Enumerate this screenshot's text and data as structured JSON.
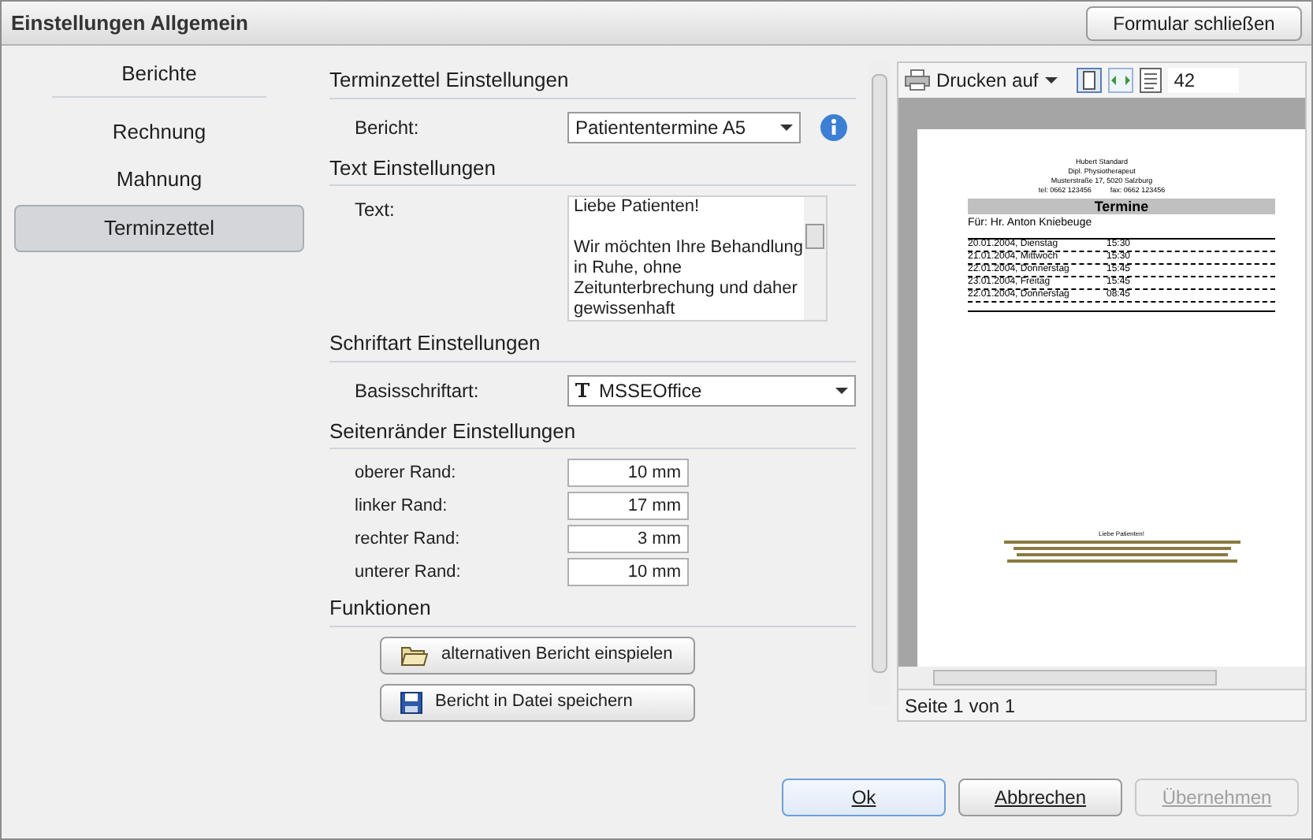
{
  "window": {
    "title": "Einstellungen Allgemein",
    "close_button": "Formular schließen"
  },
  "sidebar": {
    "title": "Berichte",
    "items": [
      {
        "label": "Rechnung",
        "selected": false
      },
      {
        "label": "Mahnung",
        "selected": false
      },
      {
        "label": "Terminzettel",
        "selected": true
      }
    ]
  },
  "settings": {
    "title": "Terminzettel Einstellungen",
    "bericht": {
      "label": "Bericht:",
      "value": "Patiententermine A5"
    },
    "text_section": {
      "title": "Text Einstellungen",
      "label": "Text:",
      "value": "Liebe Patienten!\n\nWir möchten Ihre Behandlung in Ruhe, ohne Zeitunterbrechung und daher gewissenhaft"
    },
    "font_section": {
      "title": "Schriftart Einstellungen",
      "label": "Basisschriftart:",
      "value": "MSSEOffice"
    },
    "margins_section": {
      "title": "Seitenränder Einstellungen",
      "rows": [
        {
          "label": "oberer Rand:",
          "value": "10 mm"
        },
        {
          "label": "linker Rand:",
          "value": "17 mm"
        },
        {
          "label": "rechter Rand:",
          "value": "3 mm"
        },
        {
          "label": "unterer Rand:",
          "value": "10 mm"
        }
      ]
    },
    "functions_section": {
      "title": "Funktionen",
      "buttons": [
        {
          "label": "alternativen Bericht einspielen",
          "kind": "folder"
        },
        {
          "label": "Bericht in Datei speichern",
          "kind": "save"
        }
      ]
    }
  },
  "preview": {
    "print_button": "Drucken auf",
    "zoom": "42",
    "page": {
      "header": [
        "Hubert Standard",
        "Dipl. Physiotherapeut",
        "Musterstraße 17, 5020 Salzburg"
      ],
      "tel": "tel: 0662 123456",
      "fax": "fax: 0662 123456",
      "title": "Termine",
      "recipient": "Für: Hr. Anton Kniebeuge",
      "rows": [
        {
          "date": "20.01.2004, Dienstag",
          "time": "15:30"
        },
        {
          "date": "21.01.2004, Mittwoch",
          "time": "15:30"
        },
        {
          "date": "22.01.2004, Donnerstag",
          "time": "15:45"
        },
        {
          "date": "23.01.2004, Freitag",
          "time": "15:45"
        },
        {
          "date": "22.01.2004, Donnerstag",
          "time": "08:45"
        }
      ],
      "footer_title": "Liebe Patienten!"
    },
    "status": "Seite 1 von 1"
  },
  "buttons": [
    {
      "label": "Ok",
      "disabled": false,
      "kind": "primary"
    },
    {
      "label": "Abbrechen",
      "disabled": false,
      "kind": "normal"
    },
    {
      "label": "Übernehmen",
      "disabled": true,
      "kind": "normal"
    }
  ]
}
